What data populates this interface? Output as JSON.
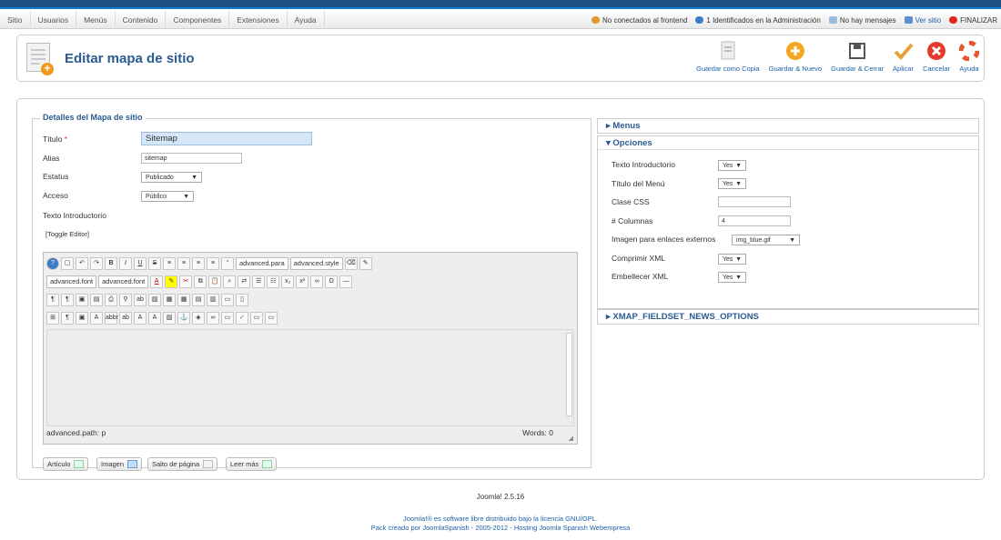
{
  "menu": {
    "items": [
      "Sitio",
      "Usuarios",
      "Menús",
      "Contenido",
      "Componentes",
      "Extensiones",
      "Ayuda"
    ]
  },
  "status": {
    "frontend": "No conectados al frontend",
    "admin": "1 Identificados en la Administración",
    "messages": "No hay mensajes",
    "view_site": "Ver sitio",
    "logout": "FINALIZAR"
  },
  "toolbar": {
    "title": "Editar mapa de sitio",
    "buttons": [
      "Guardar como Copia",
      "Guardar & Nuevo",
      "Guardar & Cerrar",
      "Aplicar",
      "Cancelar",
      "Ayuda"
    ]
  },
  "details": {
    "legend": "Detalles del Mapa de sitio",
    "title_label": "Título",
    "title_required": "*",
    "title_value": "Sitemap",
    "alias_label": "Alias",
    "alias_value": "sitemap",
    "status_label": "Estatus",
    "status_value": "Publicado",
    "access_label": "Acceso",
    "access_value": "Público",
    "intro_label": "Texto Introductorio",
    "toggle_editor": "[Toggle Editor]"
  },
  "editor": {
    "dd_paragraph": "advanced.para",
    "dd_styles": "advanced.style",
    "dd_font": "advanced.font",
    "dd_fontsize": "advanced.font",
    "path": "advanced.path: p",
    "words": "Words: 0"
  },
  "editor_buttons": [
    "Artículo",
    "Imagen",
    "Salto de página",
    "Leer más"
  ],
  "panels": {
    "menus": "Menus",
    "options": "Opciones",
    "news": "XMAP_FIELDSET_NEWS_OPTIONS"
  },
  "options": {
    "intro": "Texto Introductorio",
    "intro_val": "Yes",
    "menu_title": "Título del Menú",
    "menu_title_val": "Yes",
    "css": "Clase CSS",
    "css_val": "",
    "cols": "# Columnas",
    "cols_val": "4",
    "ext_img": "Imagen para enlaces externos",
    "ext_img_val": "img_blue.gif",
    "compress": "Comprimir XML",
    "compress_val": "Yes",
    "beautify": "Embellecer XML",
    "beautify_val": "Yes"
  },
  "footer": {
    "version": "Joomla! 2.5.16",
    "line1": "Joomla!® es software libre distribuido bajo la licencia GNU/GPL.",
    "line2": "Pack creado por JoomlaSpanish - 2005-2012 - Hosting Joomla Spanish Webempresa"
  }
}
